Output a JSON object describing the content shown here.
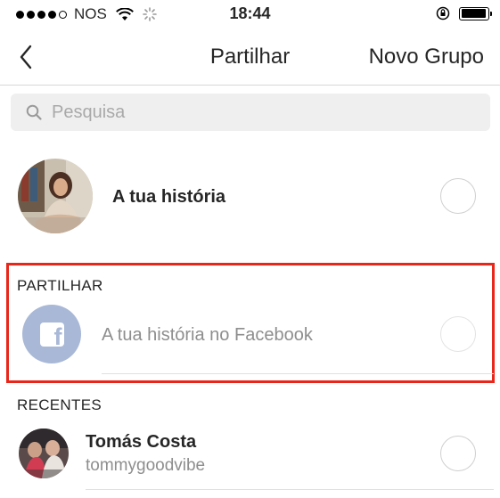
{
  "status_bar": {
    "carrier": "NOS",
    "time": "18:44",
    "battery_level": 0.95,
    "icons": [
      "signal-dots-icon",
      "wifi-icon",
      "activity-spinner-icon",
      "orientation-lock-icon",
      "battery-icon"
    ]
  },
  "nav": {
    "title": "Partilhar",
    "action_label": "Novo Grupo",
    "back_icon": "chevron-left-icon"
  },
  "search": {
    "placeholder": "Pesquisa",
    "value": ""
  },
  "story": {
    "label": "A tua história"
  },
  "share_section": {
    "header": "PARTILHAR",
    "item_label": "A tua história no Facebook",
    "highlight_color": "#e8261a"
  },
  "recents": {
    "header": "RECENTES",
    "items": [
      {
        "name": "Tomás Costa",
        "username": "tommygoodvibe"
      }
    ]
  },
  "colors": {
    "facebook_avatar": "#a8b8d6",
    "search_bg": "#efefef"
  }
}
